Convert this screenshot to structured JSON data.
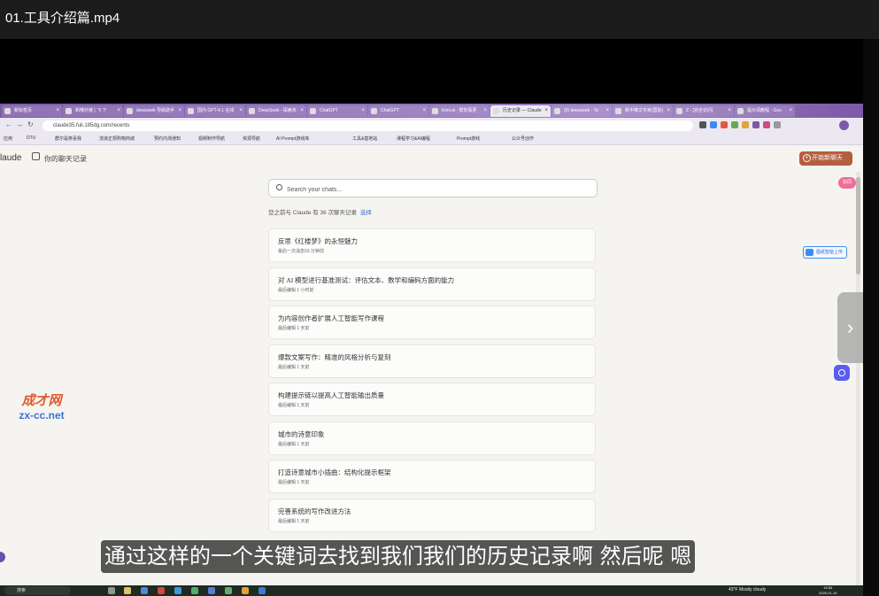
{
  "video": {
    "title": "01.工具介绍篇.mp4"
  },
  "browser": {
    "tabs": [
      {
        "label": "新标签页"
      },
      {
        "label": "和哦外链 | 飞 下"
      },
      {
        "label": "deepseek 导航助手"
      },
      {
        "label": "国内 GPT-4.1 在线"
      },
      {
        "label": "DeepSeek - 探索未"
      },
      {
        "label": "ChatGPT"
      },
      {
        "label": "ChatGPT"
      },
      {
        "label": "Kimi.ai - 帮你看更"
      },
      {
        "label": "历史记录 — Claude",
        "active": true
      },
      {
        "label": "(9) deepseek · Yo"
      },
      {
        "label": "新中推文专家(国际)"
      },
      {
        "label": "Z - [完全访问]"
      },
      {
        "label": "提示词教程 · Goo"
      }
    ],
    "url": "claude35.fuli.185dg.com/recents",
    "bookmarks": [
      "应用",
      "DTU",
      "群尔是恭喜我",
      "流浪正规购物商城",
      "预约内测通知",
      "视频制作导航",
      "资源导航",
      "AI Prompt游戏库",
      "工具&基地站",
      "课程学习&AI编程",
      "Prompt游戏",
      "公众号创作"
    ]
  },
  "page": {
    "brand": "laude",
    "history_link": "你的聊天记录",
    "new_chat": "开始新聊天",
    "pink_badge": "协同",
    "upload_button": "图纸智能上传",
    "search": {
      "placeholder": "Search your chats..."
    },
    "summary": "您之前与 Claude 有 36 次聊天记录",
    "summary_select": "选择",
    "chats": [
      {
        "title": "反思《红楼梦》的永恒魅力",
        "time": "最后一次消息53 分钟前"
      },
      {
        "title": "对 AI 模型进行基准测试：评估文本、数学和编码方面的能力",
        "time": "最后编辑 1 小时前"
      },
      {
        "title": "为内容创作者扩展人工智能写作课程",
        "time": "最后编辑 1 天前"
      },
      {
        "title": "爆款文案写作：精准的风格分析与复刻",
        "time": "最后编辑 1 天前"
      },
      {
        "title": "构建提示链以提高人工智能输出质量",
        "time": "最后编辑 1 天前"
      },
      {
        "title": "城市的诗意印象",
        "time": "最后编辑 1 天前"
      },
      {
        "title": "打造诗意城市小插曲：结构化提示框架",
        "time": "最后编辑 1 天前"
      },
      {
        "title": "完善系统的写作改进方法",
        "time": "最后编辑 1 天前"
      }
    ]
  },
  "watermark": {
    "top": "成才网",
    "bottom": "zx-cc.net"
  },
  "subtitle": "通过这样的一个关键词去找到我们我们的历史记录啊 然后呢 嗯",
  "taskbar": {
    "search": "搜索",
    "weather": "43°F  Mostly cloudy",
    "time": "16:56",
    "date": "2025-01-16"
  }
}
